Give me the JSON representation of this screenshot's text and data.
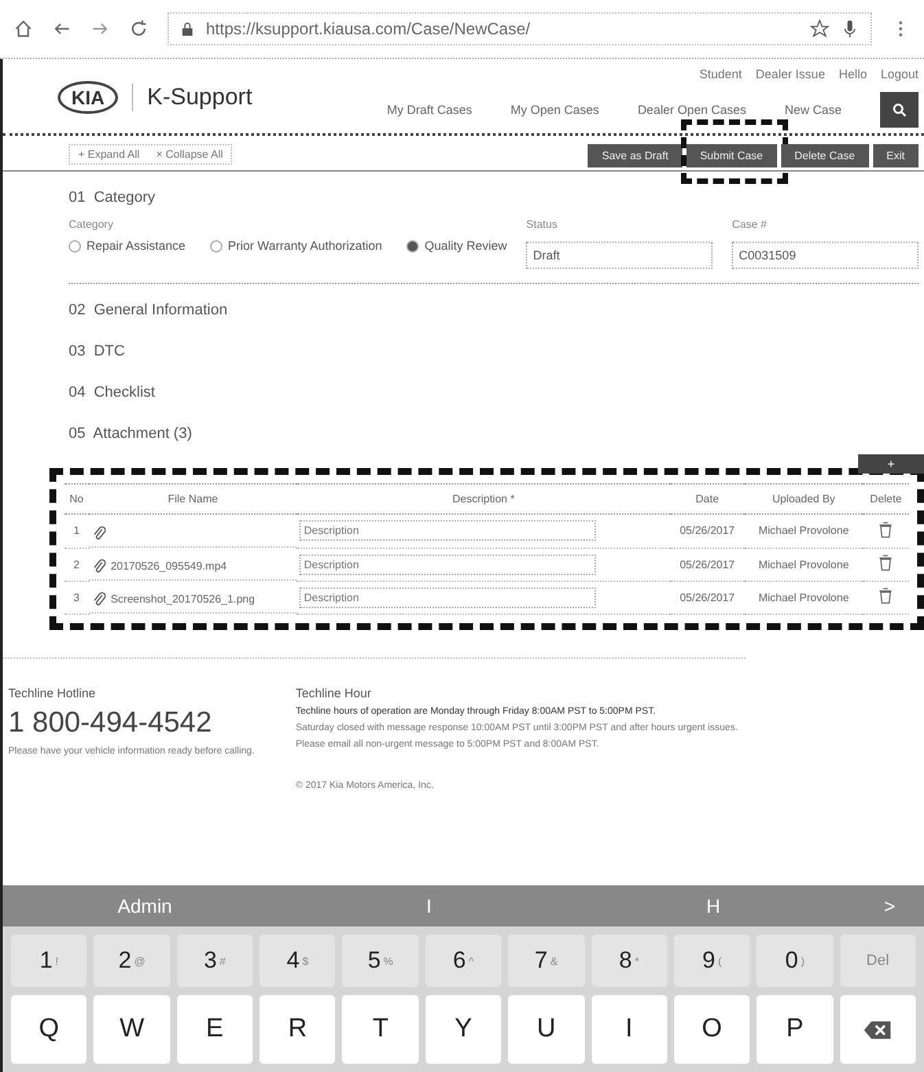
{
  "browser": {
    "url": "https://ksupport.kiausa.com/Case/NewCase/"
  },
  "header": {
    "logo": "KIA",
    "title": "K-Support",
    "user_links": [
      "Student",
      "Dealer Issue",
      "Hello",
      "Logout"
    ],
    "nav": [
      "My Draft Cases",
      "My Open Cases",
      "Dealer Open Cases",
      "New Case"
    ]
  },
  "toolbar": {
    "links": [
      "+ Expand All",
      "× Collapse All"
    ],
    "buttons": [
      {
        "label": "Save as Draft",
        "highlighted": false
      },
      {
        "label": "Submit Case",
        "highlighted": true
      },
      {
        "label": "Delete Case",
        "highlighted": false
      },
      {
        "label": "Exit",
        "highlighted": false
      }
    ]
  },
  "category": {
    "number": "01",
    "title": "Category",
    "label": "Category",
    "options": [
      {
        "label": "Repair Assistance",
        "selected": false
      },
      {
        "label": "Prior Warranty Authorization",
        "selected": false
      },
      {
        "label": "Quality Review",
        "selected": true
      }
    ],
    "status_label": "Status",
    "status": "Draft",
    "case_label": "Case #",
    "case_number": "C0031509"
  },
  "sections": [
    {
      "number": "02",
      "title": "General Information"
    },
    {
      "number": "03",
      "title": "DTC"
    },
    {
      "number": "04",
      "title": "Checklist"
    }
  ],
  "attachments": {
    "number": "05",
    "title": "Attachment (3)",
    "add": "+",
    "highlighted": true,
    "columns": [
      "No",
      "File Name",
      "Description *",
      "Date",
      "Uploaded By",
      "Delete"
    ],
    "rows": [
      {
        "no": "1",
        "file": "",
        "placeholder": "Description",
        "date": "05/26/2017",
        "by": "Michael Provolone"
      },
      {
        "no": "2",
        "file": "20170526_095549.mp4",
        "placeholder": "Description",
        "date": "05/26/2017",
        "by": "Michael Provolone"
      },
      {
        "no": "3",
        "file": "Screenshot_20170526_1.png",
        "placeholder": "Description",
        "date": "05/26/2017",
        "by": "Michael Provolone"
      }
    ]
  },
  "footer": {
    "hotline_title": "Techline Hotline",
    "phone": "1 800-494-4542",
    "hotline_note": "Please have your vehicle information ready before calling.",
    "hours_title": "Techline Hour",
    "hours_lines": [
      "Techline hours of operation are Monday through Friday 8:00AM PST to 5:00PM PST.",
      "Saturday closed with message response 10:00AM PST until 3:00PM PST and after hours urgent issues.",
      "Please email all non-urgent message to 5:00PM PST and 8:00AM PST."
    ],
    "copyright": "© 2017 Kia Motors America, Inc."
  },
  "keyboard": {
    "suggestions": [
      "Admin",
      "I",
      "H"
    ],
    "next": ">",
    "number_row": [
      {
        "key": "1",
        "alt": "!"
      },
      {
        "key": "2",
        "alt": "@"
      },
      {
        "key": "3",
        "alt": "#"
      },
      {
        "key": "4",
        "alt": "$"
      },
      {
        "key": "5",
        "alt": "%"
      },
      {
        "key": "6",
        "alt": "^"
      },
      {
        "key": "7",
        "alt": "&"
      },
      {
        "key": "8",
        "alt": "*"
      },
      {
        "key": "9",
        "alt": "("
      },
      {
        "key": "0",
        "alt": ")"
      },
      {
        "key": "Del"
      }
    ],
    "letter_row": [
      "Q",
      "W",
      "E",
      "R",
      "T",
      "Y",
      "U",
      "I",
      "O",
      "P"
    ]
  }
}
